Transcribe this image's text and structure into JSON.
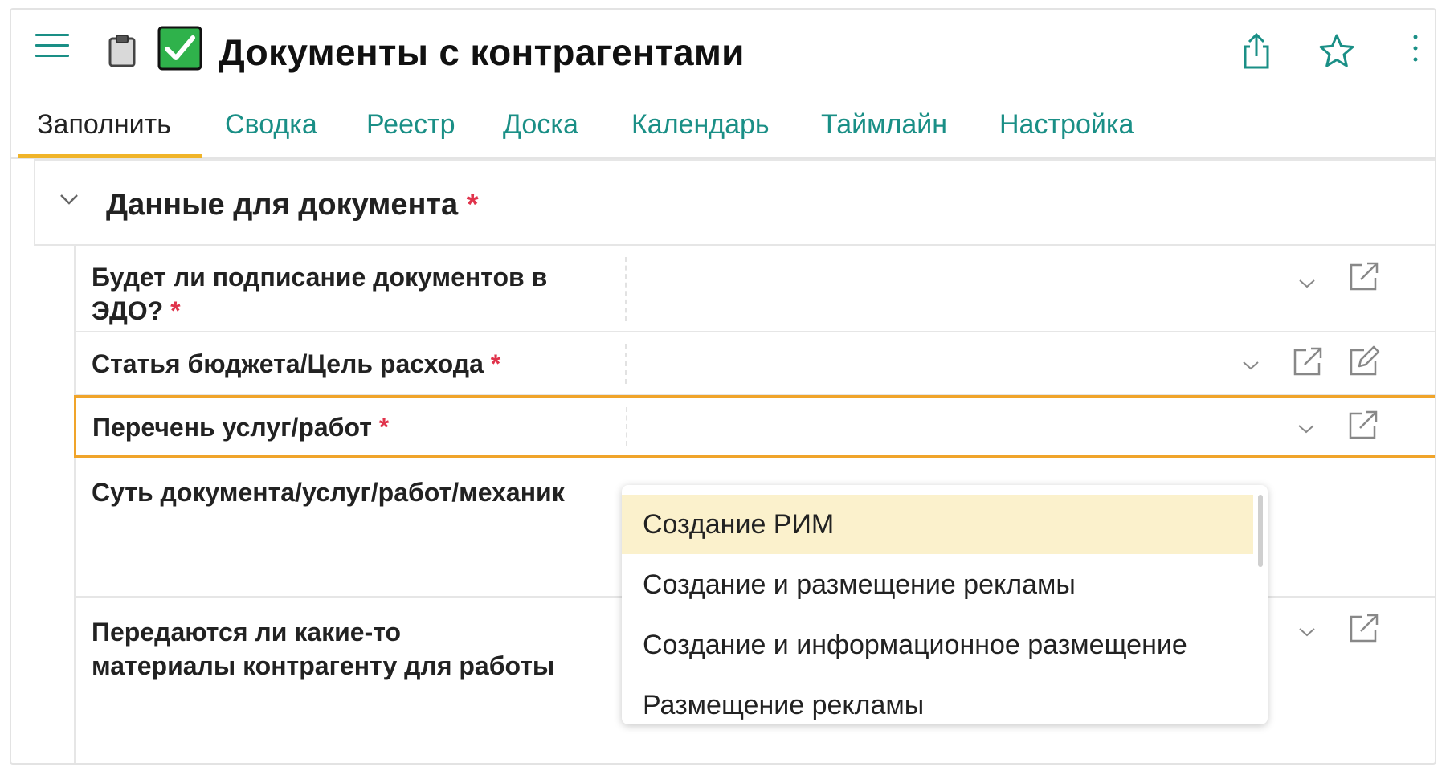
{
  "header": {
    "title": "Документы с контрагентами",
    "icons": [
      "menu-icon",
      "clipboard-icon",
      "check-mark-icon",
      "share-icon",
      "star-icon",
      "more-icon"
    ]
  },
  "tabs": [
    {
      "label": "Заполнить",
      "active": true
    },
    {
      "label": "Сводка"
    },
    {
      "label": "Реестр"
    },
    {
      "label": "Доска"
    },
    {
      "label": "Календарь"
    },
    {
      "label": "Таймлайн"
    },
    {
      "label": "Настройка"
    }
  ],
  "section": {
    "title": "Данные для документа",
    "required_mark": "*"
  },
  "fields": [
    {
      "label_line1": "Будет ли подписание документов в",
      "label_line2": "ЭДО?",
      "required_mark": "*"
    },
    {
      "label": "Статья бюджета/Цель расхода",
      "required_mark": "*"
    },
    {
      "label": "Перечень услуг/работ",
      "required_mark": "*"
    },
    {
      "label": "Суть документа/услуг/работ/механик"
    },
    {
      "label_line1": "Передаются ли какие-то",
      "label_line2": "материалы контрагенту для работы"
    }
  ],
  "dropdown": {
    "options": [
      "Создание РИМ",
      "Создание и размещение рекламы",
      "Создание и информационное размещение",
      "Размещение рекламы"
    ],
    "highlighted": "Создание РИМ"
  },
  "colors": {
    "accent": "#1a8f86",
    "tab_underline": "#f0b429",
    "required": "#e0334b",
    "focus_border": "#f0a42a",
    "option_highlight": "#fbf1cc"
  }
}
